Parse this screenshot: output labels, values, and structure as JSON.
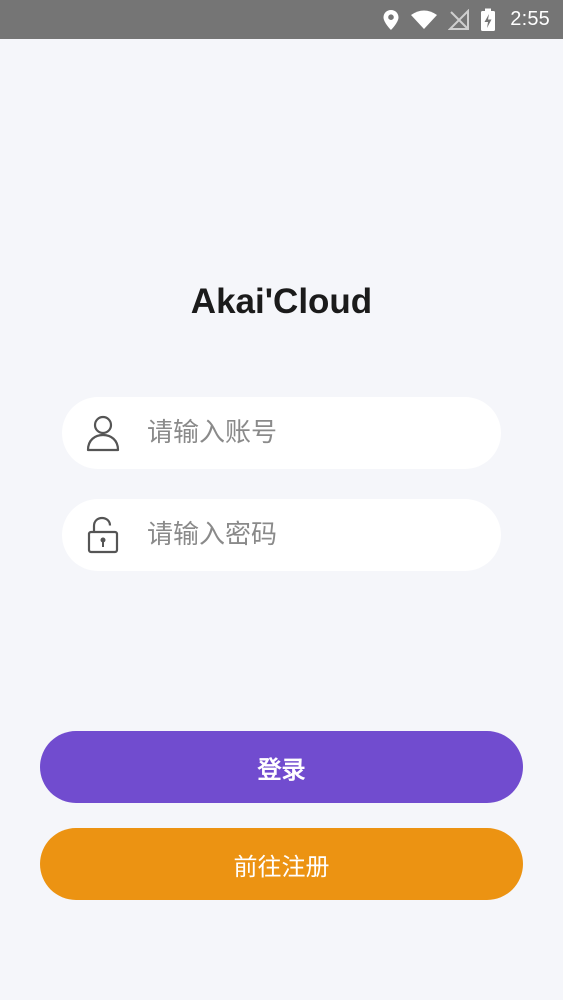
{
  "status_bar": {
    "time": "2:55",
    "icons": [
      "location-icon",
      "wifi-icon",
      "no-signal-icon",
      "battery-charging-icon"
    ],
    "background": "#757575"
  },
  "app": {
    "title": "Akai'Cloud"
  },
  "form": {
    "account": {
      "placeholder": "请输入账号",
      "value": "",
      "icon": "user-icon"
    },
    "password": {
      "placeholder": "请输入密码",
      "value": "",
      "icon": "unlock-icon"
    }
  },
  "buttons": {
    "login": {
      "label": "登录",
      "color": "#714ccf"
    },
    "register": {
      "label": "前往注册",
      "color": "#ec9312"
    }
  }
}
